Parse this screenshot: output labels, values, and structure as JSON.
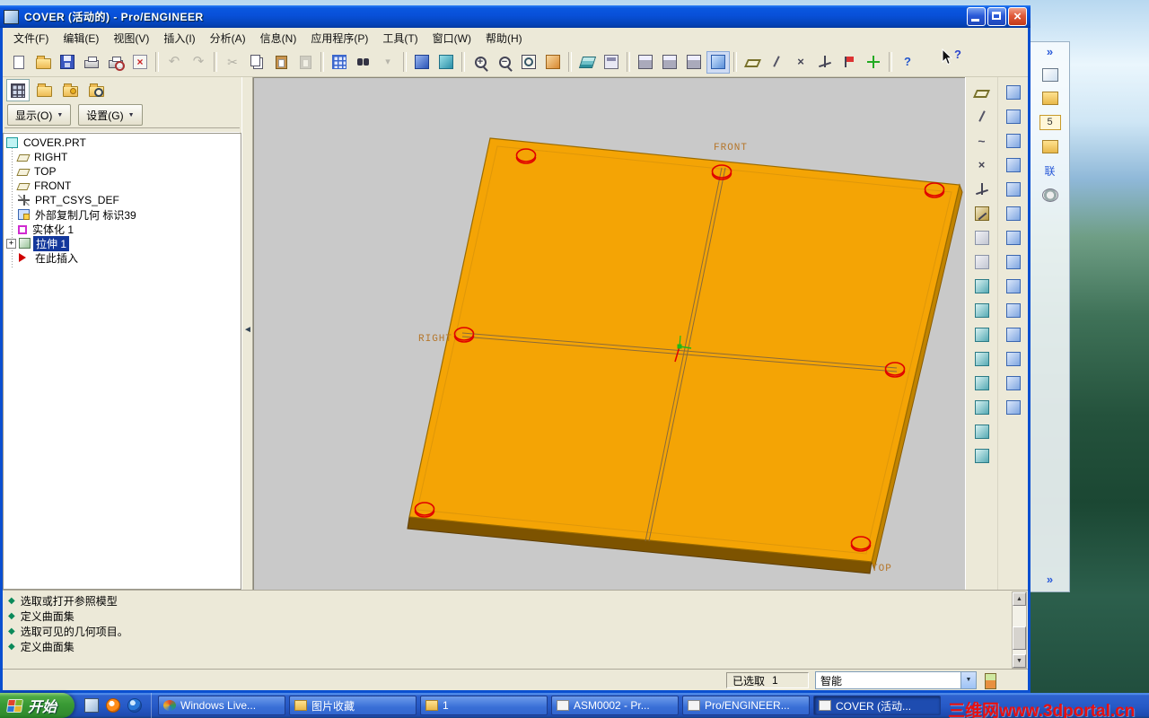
{
  "titlebar": {
    "title": "COVER (活动的) - Pro/ENGINEER"
  },
  "menubar": {
    "items": [
      "文件(F)",
      "编辑(E)",
      "视图(V)",
      "插入(I)",
      "分析(A)",
      "信息(N)",
      "应用程序(P)",
      "工具(T)",
      "窗口(W)",
      "帮助(H)"
    ]
  },
  "toolbar": {
    "icons": [
      "new",
      "open",
      "save",
      "print",
      "print-preview",
      "erase",
      "|",
      "undo",
      "redo",
      "|",
      "cut",
      "copy",
      "paste",
      "paste-special",
      "|",
      "regenerate",
      "find",
      "display-filter",
      "|",
      "sketch-view",
      "sketch-setup",
      "|",
      "zoom-in",
      "zoom-out",
      "refit",
      "repaint",
      "|",
      "layers",
      "view-manager",
      "|",
      "view-standard",
      "view-saved",
      "view-cross",
      "view-shaded",
      "|",
      "datum-planes",
      "datum-axes",
      "datum-points",
      "datum-csys",
      "annotations",
      "spin-center",
      "|",
      "context-help"
    ],
    "disabled": [
      "undo",
      "redo",
      "cut",
      "paste-special",
      "display-filter"
    ],
    "pressed": [
      "view-shaded"
    ]
  },
  "navigator": {
    "tab_icons": [
      "model-tree-tab",
      "folder-tab",
      "favorites-tab",
      "history-tab"
    ],
    "show_button": {
      "label": "显示(O)"
    },
    "settings_button": {
      "label": "设置(G)"
    },
    "tree": [
      {
        "label": "COVER.PRT",
        "icon": "part",
        "indent": 0
      },
      {
        "label": "RIGHT",
        "icon": "datum-plane",
        "indent": 1
      },
      {
        "label": "TOP",
        "icon": "datum-plane",
        "indent": 1
      },
      {
        "label": "FRONT",
        "icon": "datum-plane",
        "indent": 1
      },
      {
        "label": "PRT_CSYS_DEF",
        "icon": "csys",
        "indent": 1
      },
      {
        "label": "外部复制几何 标识39",
        "icon": "copy-geom",
        "indent": 1
      },
      {
        "label": "实体化 1",
        "icon": "solidify",
        "indent": 1
      },
      {
        "label": "拉伸 1",
        "icon": "extrude",
        "indent": 1,
        "selected": true,
        "expand": true
      },
      {
        "label": "在此插入",
        "icon": "insert-here",
        "indent": 1
      }
    ]
  },
  "viewport": {
    "labels": {
      "front": "FRONT",
      "top": "TOP",
      "right": "RIGHT"
    }
  },
  "right_toolbar_a": {
    "icons": [
      "datum-plane",
      "datum-axis",
      "datum-curve",
      "datum-point",
      "datum-csys",
      "sketch-tool",
      "analysis-tool",
      "feature-note",
      "extrude",
      "revolve",
      "sweep",
      "blend",
      "boundary-blend",
      "style-tool",
      "shell-tool",
      "round-tool"
    ]
  },
  "right_toolbar_b": {
    "icons": [
      "copy-geometry",
      "mirror-tool",
      "move-tool",
      "merge-tool",
      "trim-tool",
      "pattern-tool",
      "extend-tool",
      "offset-tool",
      "thicken-tool",
      "solidify-tool",
      "intersect-tool",
      "project-tool",
      "wrap-tool",
      "fill-tool"
    ]
  },
  "messages": {
    "icon_glyph": "◆",
    "lines": [
      "选取或打开参照模型",
      "定义曲面集",
      "选取可见的几何项目。",
      "定义曲面集"
    ]
  },
  "statusbar": {
    "selected_label": "已选取",
    "selected_count": "1",
    "filter_label": "智能"
  },
  "taskbar": {
    "start_label": "开始",
    "quick_launch": [
      "show-desktop",
      "media-player",
      "browser"
    ],
    "items": [
      {
        "label": "Windows Live...",
        "icon": "msn"
      },
      {
        "label": "图片收藏",
        "icon": "folder"
      },
      {
        "label": "1",
        "icon": "folder"
      },
      {
        "label": "ASM0002 - Pr...",
        "icon": "proe"
      },
      {
        "label": "Pro/ENGINEER...",
        "icon": "proe"
      },
      {
        "label": "COVER (活动...",
        "icon": "proe",
        "active": true
      }
    ]
  },
  "side_panel": {
    "chevron_top": "»",
    "badge": "5",
    "link_label": "联",
    "chevron_bottom": "»"
  },
  "cursor": {
    "help_glyph": "?"
  },
  "watermark": {
    "text": "三维网www.3dportal.cn"
  },
  "colors": {
    "titlebar_blue": "#0850d8",
    "taskbar_blue": "#2659c6",
    "start_green": "#3a9a35",
    "plate_orange": "#f4a405",
    "plate_side_brown": "#7d5300",
    "highlight_red": "#e00000",
    "selection_navy": "#14389c",
    "viewport_gray": "#c9c9c9",
    "datum_label_tan": "#b5762a"
  }
}
